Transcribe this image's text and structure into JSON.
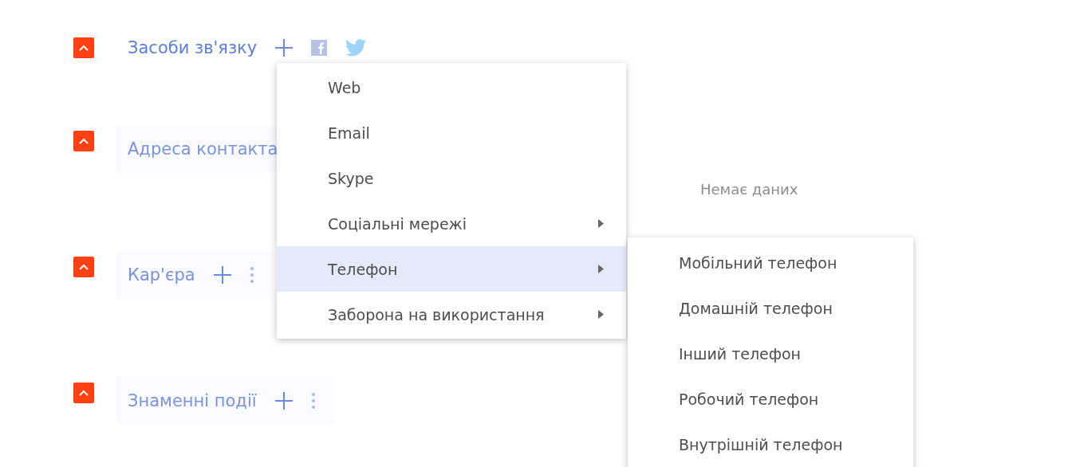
{
  "sections": [
    {
      "title": "Засоби зв'язку",
      "expanded": true,
      "blurred": false,
      "actions": [
        {
          "kind": "add"
        },
        {
          "kind": "facebook"
        },
        {
          "kind": "twitter"
        }
      ]
    },
    {
      "title": "Адреса контакта",
      "expanded": true,
      "blurred": true,
      "empty_message": "Немає даних"
    },
    {
      "title": "Кар'єра",
      "expanded": true,
      "blurred": true,
      "actions": [
        {
          "kind": "add"
        },
        {
          "kind": "more"
        }
      ]
    },
    {
      "title": "Знаменні події",
      "expanded": true,
      "blurred": true,
      "actions": [
        {
          "kind": "add"
        },
        {
          "kind": "more"
        }
      ]
    }
  ],
  "menu": {
    "items": [
      {
        "label": "Web",
        "selected": false,
        "has_submenu": false
      },
      {
        "label": "Email",
        "selected": false,
        "has_submenu": false
      },
      {
        "label": "Skype",
        "selected": false,
        "has_submenu": false
      },
      {
        "label": "Соціальні мережі",
        "selected": false,
        "has_submenu": true
      },
      {
        "label": "Телефон",
        "selected": true,
        "has_submenu": true
      },
      {
        "label": "Заборона на використання",
        "selected": false,
        "has_submenu": true
      }
    ]
  },
  "submenu": {
    "items": [
      {
        "label": "Мобільний телефон",
        "selected": false
      },
      {
        "label": "Домашній телефон",
        "selected": false
      },
      {
        "label": "Інший телефон",
        "selected": false
      },
      {
        "label": "Робочий телефон",
        "selected": false
      },
      {
        "label": "Внутрішній телефон",
        "selected": false
      }
    ]
  }
}
